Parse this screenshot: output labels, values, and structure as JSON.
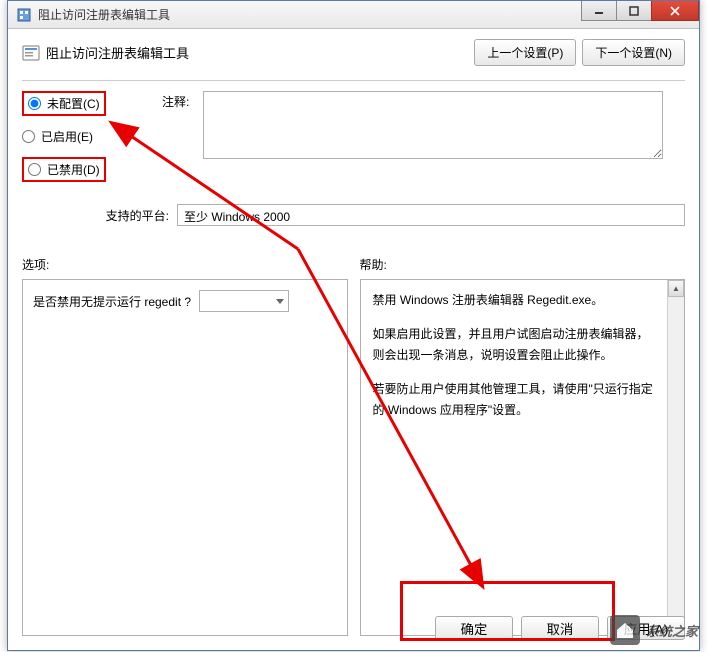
{
  "titlebar": {
    "title": "阻止访问注册表编辑工具"
  },
  "header": {
    "title": "阻止访问注册表编辑工具",
    "prev": "上一个设置(P)",
    "next": "下一个设置(N)"
  },
  "radios": {
    "not_configured": "未配置(C)",
    "enabled": "已启用(E)",
    "disabled": "已禁用(D)"
  },
  "comment": {
    "label": "注释:"
  },
  "supported": {
    "label": "支持的平台:",
    "value": "至少 Windows 2000"
  },
  "columns": {
    "options_label": "选项:",
    "help_label": "帮助:"
  },
  "option_line": "是否禁用无提示运行 regedit ?",
  "help": {
    "p1": "禁用 Windows 注册表编辑器 Regedit.exe。",
    "p2": "如果启用此设置，并且用户试图启动注册表编辑器，则会出现一条消息，说明设置会阻止此操作。",
    "p3": "若要防止用户使用其他管理工具，请使用\"只运行指定的 Windows 应用程序\"设置。"
  },
  "footer": {
    "ok": "确定",
    "cancel": "取消",
    "apply": "应用(A)"
  },
  "watermark": {
    "text": "系统之家"
  }
}
